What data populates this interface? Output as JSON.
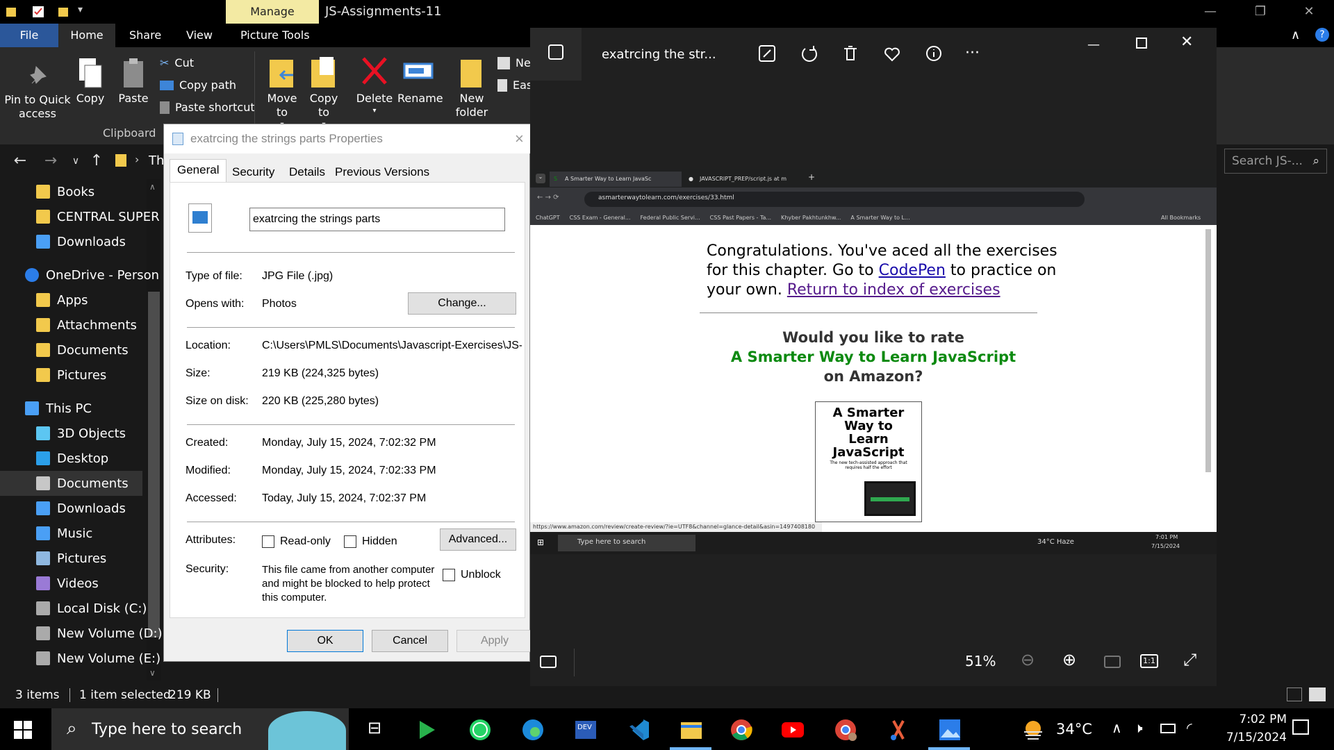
{
  "explorer": {
    "window_title": "JS-Assignments-11",
    "manage_tab": "Manage",
    "menu": [
      "File",
      "Home",
      "Share",
      "View",
      "Picture Tools"
    ],
    "ribbon": {
      "pin_label": "Pin to Quick access",
      "copy_label": "Copy",
      "paste_label": "Paste",
      "cut_label": "Cut",
      "copy_path_label": "Copy path",
      "paste_shortcut_label": "Paste shortcut",
      "clipboard_group": "Clipboard",
      "move_to_label": "Move to",
      "copy_to_label": "Copy to",
      "delete_label": "Delete",
      "rename_label": "Rename",
      "new_folder_label": "New folder",
      "new_item_partial": "Ne",
      "easy_access_partial": "Eas"
    },
    "address_partial": "Th",
    "search_placeholder": "Search JS-...",
    "sidebar": [
      {
        "label": "Books",
        "icon": "folder-icon"
      },
      {
        "label": "CENTRAL SUPER",
        "icon": "folder-icon"
      },
      {
        "label": "Downloads",
        "icon": "download-icon"
      },
      {
        "label": "OneDrive - Person",
        "icon": "cloud-icon"
      },
      {
        "label": "Apps",
        "icon": "folder-icon"
      },
      {
        "label": "Attachments",
        "icon": "folder-icon"
      },
      {
        "label": "Documents",
        "icon": "folder-icon"
      },
      {
        "label": "Pictures",
        "icon": "folder-icon"
      },
      {
        "label": "This PC",
        "icon": "computer-icon"
      },
      {
        "label": "3D Objects",
        "icon": "cube-icon"
      },
      {
        "label": "Desktop",
        "icon": "desktop-icon"
      },
      {
        "label": "Documents",
        "icon": "document-icon"
      },
      {
        "label": "Downloads",
        "icon": "download-icon"
      },
      {
        "label": "Music",
        "icon": "music-icon"
      },
      {
        "label": "Pictures",
        "icon": "pictures-icon"
      },
      {
        "label": "Videos",
        "icon": "videos-icon"
      },
      {
        "label": "Local Disk (C:)",
        "icon": "drive-icon"
      },
      {
        "label": "New Volume (D:)",
        "icon": "drive-icon"
      },
      {
        "label": "New Volume (E:)",
        "icon": "drive-icon"
      }
    ],
    "status": {
      "items": "3 items",
      "selected": "1 item selected",
      "size": "219 KB"
    }
  },
  "properties": {
    "title": "exatrcing the strings parts Properties",
    "tabs": [
      "General",
      "Security",
      "Details",
      "Previous Versions"
    ],
    "filename": "exatrcing the strings parts",
    "type_label": "Type of file:",
    "type_value": "JPG File (.jpg)",
    "opens_label": "Opens with:",
    "opens_value": "Photos",
    "change_button": "Change...",
    "location_label": "Location:",
    "location_value": "C:\\Users\\PMLS\\Documents\\Javascript-Exercises\\JS-",
    "size_label": "Size:",
    "size_value": "219 KB (224,325 bytes)",
    "size_disk_label": "Size on disk:",
    "size_disk_value": "220 KB (225,280 bytes)",
    "created_label": "Created:",
    "created_value": "Monday, July 15, 2024, 7:02:32 PM",
    "modified_label": "Modified:",
    "modified_value": "Monday, July 15, 2024, 7:02:33 PM",
    "accessed_label": "Accessed:",
    "accessed_value": "Today, July 15, 2024, 7:02:37 PM",
    "attributes_label": "Attributes:",
    "readonly_label": "Read-only",
    "hidden_label": "Hidden",
    "advanced_button": "Advanced...",
    "security_label": "Security:",
    "security_text": "This file came from another computer and might be blocked to help protect this computer.",
    "unblock_label": "Unblock",
    "ok_button": "OK",
    "cancel_button": "Cancel",
    "apply_button": "Apply"
  },
  "photos": {
    "title": "exatrcing the str...",
    "zoom": "51%",
    "shot": {
      "tab1": "A Smarter Way to Learn JavaSc",
      "tab2": "JAVASCRIPT_PREP/script.js at m",
      "url": "asmarterwaytolearn.com/exercises/33.html",
      "bookmarks": [
        "ChatGPT",
        "CSS Exam - General...",
        "Federal Public Servi...",
        "CSS Past Papers - Ta...",
        "Khyber Pakhtunkhw...",
        "A Smarter Way to L..."
      ],
      "all_bookmarks": "All Bookmarks",
      "congrats_1": "Congratulations. You've aced all the exercises",
      "congrats_2a": "for this chapter. Go to ",
      "codepen": "CodePen",
      "congrats_2b": " to practice on",
      "congrats_3a": "your own. ",
      "return_link": "Return to index of exercises",
      "rate_1": "Would you like to rate",
      "rate_2": "A Smarter Way to Learn JavaScript",
      "rate_3": "on Amazon?",
      "book_title": "A Smarter Way to Learn JavaScript",
      "book_sub": "The new tech-assisted approach that requires half the effort",
      "status_url": "https://www.amazon.com/review/create-review/?ie=UTF8&channel=glance-detail&asin=1497408180",
      "tb_search": "Type here to search",
      "tb_weather": "34°C  Haze",
      "tb_time": "7:01 PM",
      "tb_date": "7/15/2024"
    }
  },
  "taskbar": {
    "search_placeholder": "Type here to search",
    "temperature": "34°C",
    "time": "7:02 PM",
    "date": "7/15/2024"
  },
  "colors": {
    "file_tab": "#2b579a",
    "manage_tab": "#f3eaa3",
    "link_blue": "#1a0dab",
    "link_visited": "#551a8b",
    "green_title": "#0c8a10"
  }
}
